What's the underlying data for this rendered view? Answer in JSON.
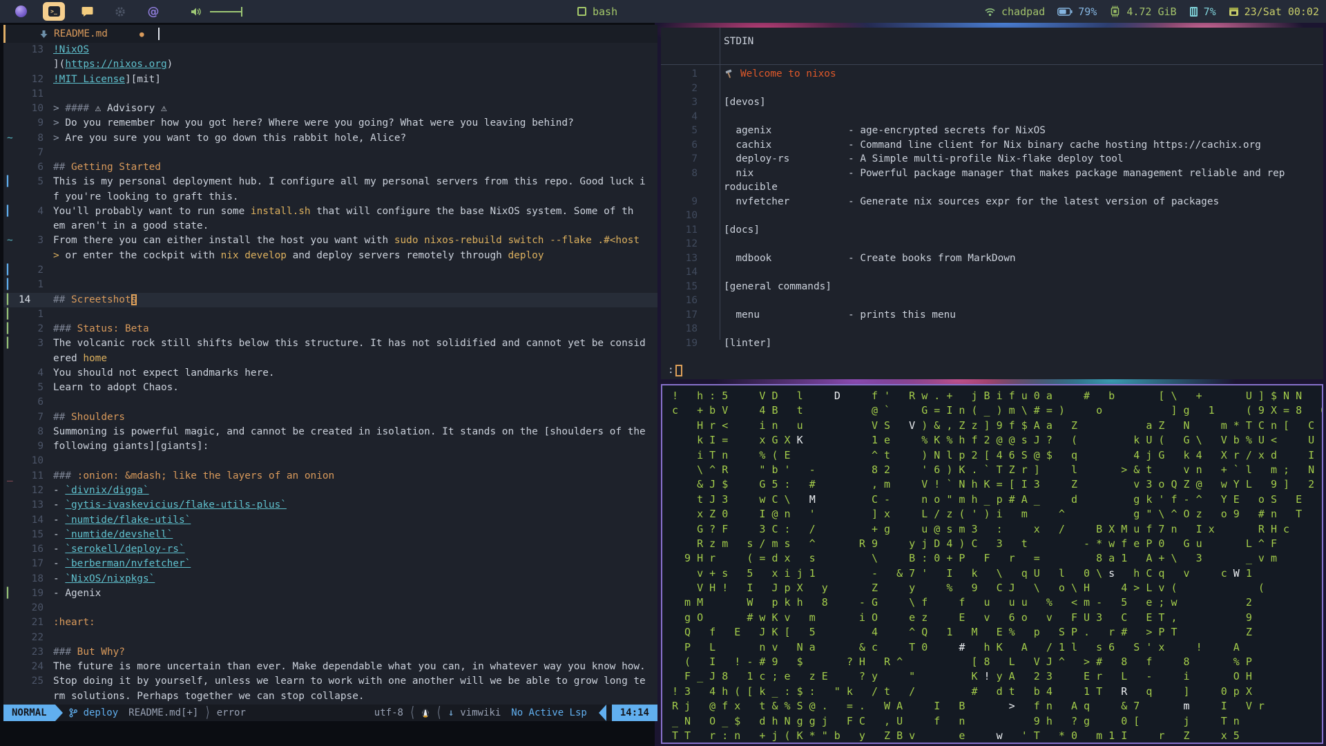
{
  "topbar": {
    "workspaces": [
      {
        "name": "firefox"
      },
      {
        "name": "terminal",
        "active": true,
        "glyph": ">_"
      },
      {
        "name": "chat"
      },
      {
        "name": "settings"
      },
      {
        "name": "spiral",
        "glyph": "@"
      }
    ],
    "center": {
      "title": "bash"
    },
    "status": {
      "network": "chadpad",
      "battery": "79%",
      "memory": "4.72 GiB",
      "cpu": "7%",
      "clock": "23/Sat 00:02"
    }
  },
  "editor": {
    "tab": {
      "title": "README.md",
      "modified_dot": "●"
    },
    "statusline": {
      "mode": "NORMAL",
      "branch": "deploy",
      "file": "README.md[+]",
      "sep_r": "⟩",
      "diag": "error",
      "encoding": "utf-8",
      "sep_l": "⟨",
      "filetype_arrow": "↓",
      "filetype": "vimwiki",
      "lsp": "No Active Lsp",
      "time": "14:14"
    },
    "rows": [
      {
        "n": "13",
        "seg": [
          [
            "!NixOS",
            "lk"
          ]
        ]
      },
      {
        "n": "",
        "seg": [
          [
            "](",
            "tx"
          ],
          [
            "https://nixos.org",
            "lk"
          ],
          [
            ")",
            "tx"
          ]
        ]
      },
      {
        "n": "12",
        "seg": [
          [
            "!MIT License",
            "lk"
          ],
          [
            "][mit]",
            "tx"
          ]
        ]
      },
      {
        "n": "11",
        "seg": []
      },
      {
        "n": "10",
        "seg": [
          [
            "> ",
            "qt"
          ],
          [
            "#### ",
            "hs"
          ],
          [
            "⚠ Advisory ⚠",
            "tx"
          ]
        ]
      },
      {
        "n": "9",
        "seg": [
          [
            "> ",
            "qt"
          ],
          [
            "Do you remember how you got here? Where were you going? What were you leaving behind?",
            "tx"
          ]
        ]
      },
      {
        "n": "8",
        "sign": "tilde",
        "seg": [
          [
            "> ",
            "qt"
          ],
          [
            "Are you sure you want to go down this rabbit hole, Alice?",
            "tx"
          ]
        ]
      },
      {
        "n": "7",
        "seg": []
      },
      {
        "n": "6",
        "seg": [
          [
            "## ",
            "hs"
          ],
          [
            "Getting Started",
            "hd"
          ]
        ]
      },
      {
        "n": "5",
        "sign": "barb",
        "seg": [
          [
            "This is my personal deployment hub. I configure all my personal servers from this repo. Good luck i",
            "tx"
          ]
        ]
      },
      {
        "n": "",
        "seg": [
          [
            "f you're looking to graft this.",
            "tx"
          ]
        ]
      },
      {
        "n": "4",
        "sign": "barb",
        "seg": [
          [
            "You'll probably want to run some ",
            "tx"
          ],
          [
            "install.sh",
            "cd"
          ],
          [
            " that will configure the base NixOS system. Some of th",
            "tx"
          ]
        ]
      },
      {
        "n": "",
        "seg": [
          [
            "em aren't in a good state.",
            "tx"
          ]
        ]
      },
      {
        "n": "3",
        "sign": "tilde",
        "seg": [
          [
            "From there you can either install the host you want with ",
            "tx"
          ],
          [
            "sudo nixos-rebuild switch --flake .#<host",
            "cd"
          ]
        ]
      },
      {
        "n": "",
        "seg": [
          [
            ">",
            "cd"
          ],
          [
            " or enter the cockpit with ",
            "tx"
          ],
          [
            "nix develop",
            "cd"
          ],
          [
            " and deploy servers remotely through ",
            "tx"
          ],
          [
            "deploy",
            "cd"
          ]
        ]
      },
      {
        "n": "2",
        "sign": "barb",
        "seg": []
      },
      {
        "n": "1",
        "sign": "barb",
        "seg": []
      },
      {
        "n": "14",
        "cur": true,
        "sign": "barg",
        "seg": [
          [
            "## ",
            "hs"
          ],
          [
            "Screetshot",
            "hd"
          ],
          [
            "s",
            "cursor"
          ]
        ]
      },
      {
        "n": "1",
        "sign": "barg",
        "seg": []
      },
      {
        "n": "2",
        "sign": "barg",
        "seg": [
          [
            "### ",
            "hs"
          ],
          [
            "Status: Beta",
            "hd"
          ]
        ]
      },
      {
        "n": "3",
        "sign": "barg",
        "seg": [
          [
            "The volcanic rock still shifts below this structure. It has not solidified and cannot yet be consid",
            "tx"
          ]
        ]
      },
      {
        "n": "",
        "seg": [
          [
            "ered ",
            "tx"
          ],
          [
            "home",
            "cd"
          ]
        ]
      },
      {
        "n": "4",
        "seg": [
          [
            "You should not expect landmarks here.",
            "tx"
          ]
        ]
      },
      {
        "n": "5",
        "seg": [
          [
            "Learn to adopt Chaos.",
            "tx"
          ]
        ]
      },
      {
        "n": "6",
        "seg": []
      },
      {
        "n": "7",
        "seg": [
          [
            "## ",
            "hs"
          ],
          [
            "Shoulders",
            "hd"
          ]
        ]
      },
      {
        "n": "8",
        "seg": [
          [
            "Summoning is powerful magic, and cannot be created in isolation. It stands on the [shoulders of the",
            "tx"
          ]
        ]
      },
      {
        "n": "9",
        "seg": [
          [
            "following giants][giants]:",
            "tx"
          ]
        ]
      },
      {
        "n": "10",
        "seg": []
      },
      {
        "n": "11",
        "sign": "del",
        "seg": [
          [
            "### ",
            "hs"
          ],
          [
            ":onion: &mdash; like the layers of an onion",
            "hd"
          ]
        ]
      },
      {
        "n": "12",
        "seg": [
          [
            "- ",
            "tx"
          ],
          [
            "`divnix/digga`",
            "lk"
          ]
        ]
      },
      {
        "n": "13",
        "seg": [
          [
            "- ",
            "tx"
          ],
          [
            "`gytis-ivaskevicius/flake-utils-plus`",
            "lk"
          ]
        ]
      },
      {
        "n": "14",
        "seg": [
          [
            "- ",
            "tx"
          ],
          [
            "`numtide/flake-utils`",
            "lk"
          ]
        ]
      },
      {
        "n": "15",
        "seg": [
          [
            "- ",
            "tx"
          ],
          [
            "`numtide/devshell`",
            "lk"
          ]
        ]
      },
      {
        "n": "16",
        "seg": [
          [
            "- ",
            "tx"
          ],
          [
            "`serokell/deploy-rs`",
            "lk"
          ]
        ]
      },
      {
        "n": "17",
        "seg": [
          [
            "- ",
            "tx"
          ],
          [
            "`berberman/nvfetcher`",
            "lk"
          ]
        ]
      },
      {
        "n": "18",
        "seg": [
          [
            "- ",
            "tx"
          ],
          [
            "`NixOS/nixpkgs`",
            "lk"
          ]
        ]
      },
      {
        "n": "19",
        "sign": "barg",
        "seg": [
          [
            "- Agenix",
            "tx"
          ]
        ]
      },
      {
        "n": "20",
        "seg": []
      },
      {
        "n": "21",
        "seg": [
          [
            ":heart:",
            "hd"
          ]
        ]
      },
      {
        "n": "22",
        "seg": []
      },
      {
        "n": "23",
        "seg": [
          [
            "### ",
            "hs"
          ],
          [
            "But Why?",
            "hd"
          ]
        ]
      },
      {
        "n": "24",
        "seg": [
          [
            "The future is more uncertain than ever. Make dependable what you can, in whatever way you know how.",
            "tx"
          ]
        ]
      },
      {
        "n": "25",
        "seg": [
          [
            "Stop doing it by yourself, unless we learn to work with one another will we be able to grow long te",
            "tx"
          ]
        ]
      },
      {
        "n": "",
        "seg": [
          [
            "rm solutions. Perhaps together we can stop collapse.",
            "tx"
          ]
        ]
      }
    ]
  },
  "pager": {
    "title": "STDIN",
    "prompt": ":",
    "rows": [
      {
        "n": "1",
        "welcome": "Welcome to nixos"
      },
      {
        "n": "2"
      },
      {
        "n": "3",
        "text": "[devos]"
      },
      {
        "n": "4"
      },
      {
        "n": "5",
        "name": "agenix",
        "desc": "- age-encrypted secrets for NixOS"
      },
      {
        "n": "6",
        "name": "cachix",
        "desc": "- Command line client for Nix binary cache hosting https://cachix.org"
      },
      {
        "n": "7",
        "name": "deploy-rs",
        "desc": "- A Simple multi-profile Nix-flake deploy tool"
      },
      {
        "n": "8",
        "name": "nix",
        "desc": "- Powerful package manager that makes package management reliable and rep"
      },
      {
        "n": "",
        "text": "roducible"
      },
      {
        "n": "9",
        "name": "nvfetcher",
        "desc": "- Generate nix sources expr for the latest version of packages"
      },
      {
        "n": "10"
      },
      {
        "n": "11",
        "text": "[docs]"
      },
      {
        "n": "12"
      },
      {
        "n": "13",
        "name": "mdbook",
        "desc": "- Create books from MarkDown"
      },
      {
        "n": "14"
      },
      {
        "n": "15",
        "text": "[general commands]"
      },
      {
        "n": "16"
      },
      {
        "n": "17",
        "name": "menu",
        "desc": "- prints this menu"
      },
      {
        "n": "18"
      },
      {
        "n": "19",
        "text": "[linter]"
      }
    ]
  },
  "matrix": {
    "rows": [
      [
        [
          "!   h : 5     V D   l     ",
          "g"
        ],
        [
          "D",
          "w"
        ],
        [
          "     f '   R w . +   j B i f u 0 a     #   b       [ \\   +       U ] $ N N",
          "g"
        ]
      ],
      [
        [
          "c   + b V     4 B   t           @ `     G = I n ( _ ) m \\ # = )     o           ] g   1     ( 9 X = 8   0",
          "g"
        ]
      ],
      [
        [
          "    H r <     i n   u           V S   ",
          "g"
        ],
        [
          "V",
          "w"
        ],
        [
          " ) & , Z z ] 9 f $ A a   Z           a Z   N     m * T C n [   C",
          "g"
        ]
      ],
      [
        [
          "    k I =     x G X ",
          "g"
        ],
        [
          "K",
          "w"
        ],
        [
          "           1 e     % K % h f 2 @ @ s J ?   (         k U (   G \\   V b % U <     U",
          "g"
        ]
      ],
      [
        [
          "    i T n     % ( E             ^ t     ) N l p 2 [ 4 6 S @ $   q         4 j G   k 4   X r / x d     I",
          "g"
        ]
      ],
      [
        [
          "    \\ ^ R     \" b '   -         8 2     ' 6 ) K . ` T Z r ]     l       > & t     v n   + ` l   m ;   N",
          "g"
        ]
      ],
      [
        [
          "    & J $     G 5 :   #         , m     V ! ` N h K = [ I 3     Z         v 3 o Q Z @   w Y L   9 ]   2",
          "g"
        ]
      ],
      [
        [
          "    t J 3     w C \\   ",
          "g"
        ],
        [
          "M",
          "w"
        ],
        [
          "         C -     n o \" m h _ p # A _     d         g k ' f - ^   Y E   o S   E",
          "g"
        ]
      ],
      [
        [
          "    x Z 0     I @ n   '         ] x     L / z ( ' ) i   m     ^           g \" \\ ^ O z   o 9   # n   T",
          "g"
        ]
      ],
      [
        [
          "    G ? F     3 C :   /         + g     u @ s m 3   :     x   /     B X M u f 7 n   I x       R H c",
          "g"
        ]
      ],
      [
        [
          "    R z m   s / m s   ^       R 9     y j D 4 ) C   3   t         - * w f e P 0   G u       L ^ F",
          "g"
        ]
      ],
      [
        [
          "  9 H r     ( = d x   s         \\     B : 0 + P   F   r   =         8 a 1   A + \\   3       _ v m",
          "g"
        ]
      ],
      [
        [
          "    v + s   5   x i j 1         -   & 7 '   I   k   \\   q U   l   0 \\ ",
          "g"
        ],
        [
          "s",
          "w"
        ],
        [
          "   h C q   v     c ",
          "g"
        ],
        [
          "W",
          "w"
        ],
        [
          " 1",
          "g"
        ]
      ],
      [
        [
          "    V H !   I   J p X   y       Z     y     %   9   C J   \\   o \\ H     4 > L v (             (",
          "g"
        ]
      ],
      [
        [
          "  m M       W   p k h   8     - G     \\ f     f   u   u u   %   < m -   5   e ; w           2",
          "g"
        ]
      ],
      [
        [
          "  g O       # w K v   m       i O     e z     E   v   6 o   v   F U 3   C   E T ,           9",
          "g"
        ]
      ],
      [
        [
          "  Q   f   E   J K [   5         4     ^ Q   1   M   E %   p   S P .   r #   > P T           Z",
          "g"
        ]
      ],
      [
        [
          "  P   L       n v   N a       & c     T 0     ",
          "g"
        ],
        [
          "#",
          "w"
        ],
        [
          "   h K   A   / 1 l   s 6   S ' x     !     A",
          "g"
        ]
      ],
      [
        [
          "  (   I   ! - # 9   $       ? H   R ^           [ 8   L   V J ^   > #   8   f     8       % P",
          "g"
        ]
      ],
      [
        [
          "  F _ J 8   1 c ; e   z E     ? y     \"         K ",
          "g"
        ],
        [
          "!",
          "w"
        ],
        [
          " y A   2 3     E r   L   -     i       O H",
          "g"
        ]
      ],
      [
        [
          "! 3   4 h ( [ k _ : $ :   \" k   / t   /         #   d t   b 4     1 T   ",
          "g"
        ],
        [
          "R",
          "w"
        ],
        [
          "   q     ]     0 p X",
          "g"
        ]
      ],
      [
        [
          "R j   @ f x   t & % S @ .   = .   W A     I   B       ",
          "g"
        ],
        [
          ">",
          "w"
        ],
        [
          "   f n   A q     & 7       ",
          "g"
        ],
        [
          "m",
          "w"
        ],
        [
          "     I   V r",
          "g"
        ]
      ],
      [
        [
          "_ N   O _ $   d h N g g j   F C   , U     f   n           9 h   ? g     0 [       j     T n",
          "g"
        ]
      ],
      [
        [
          "T T   r : n   + j ( K * \" b   y   Z B v       e     ",
          "g"
        ],
        [
          "w",
          "w"
        ],
        [
          "   ' T   * 0   m 1 I     r   Z     x 5",
          "g"
        ]
      ]
    ]
  }
}
